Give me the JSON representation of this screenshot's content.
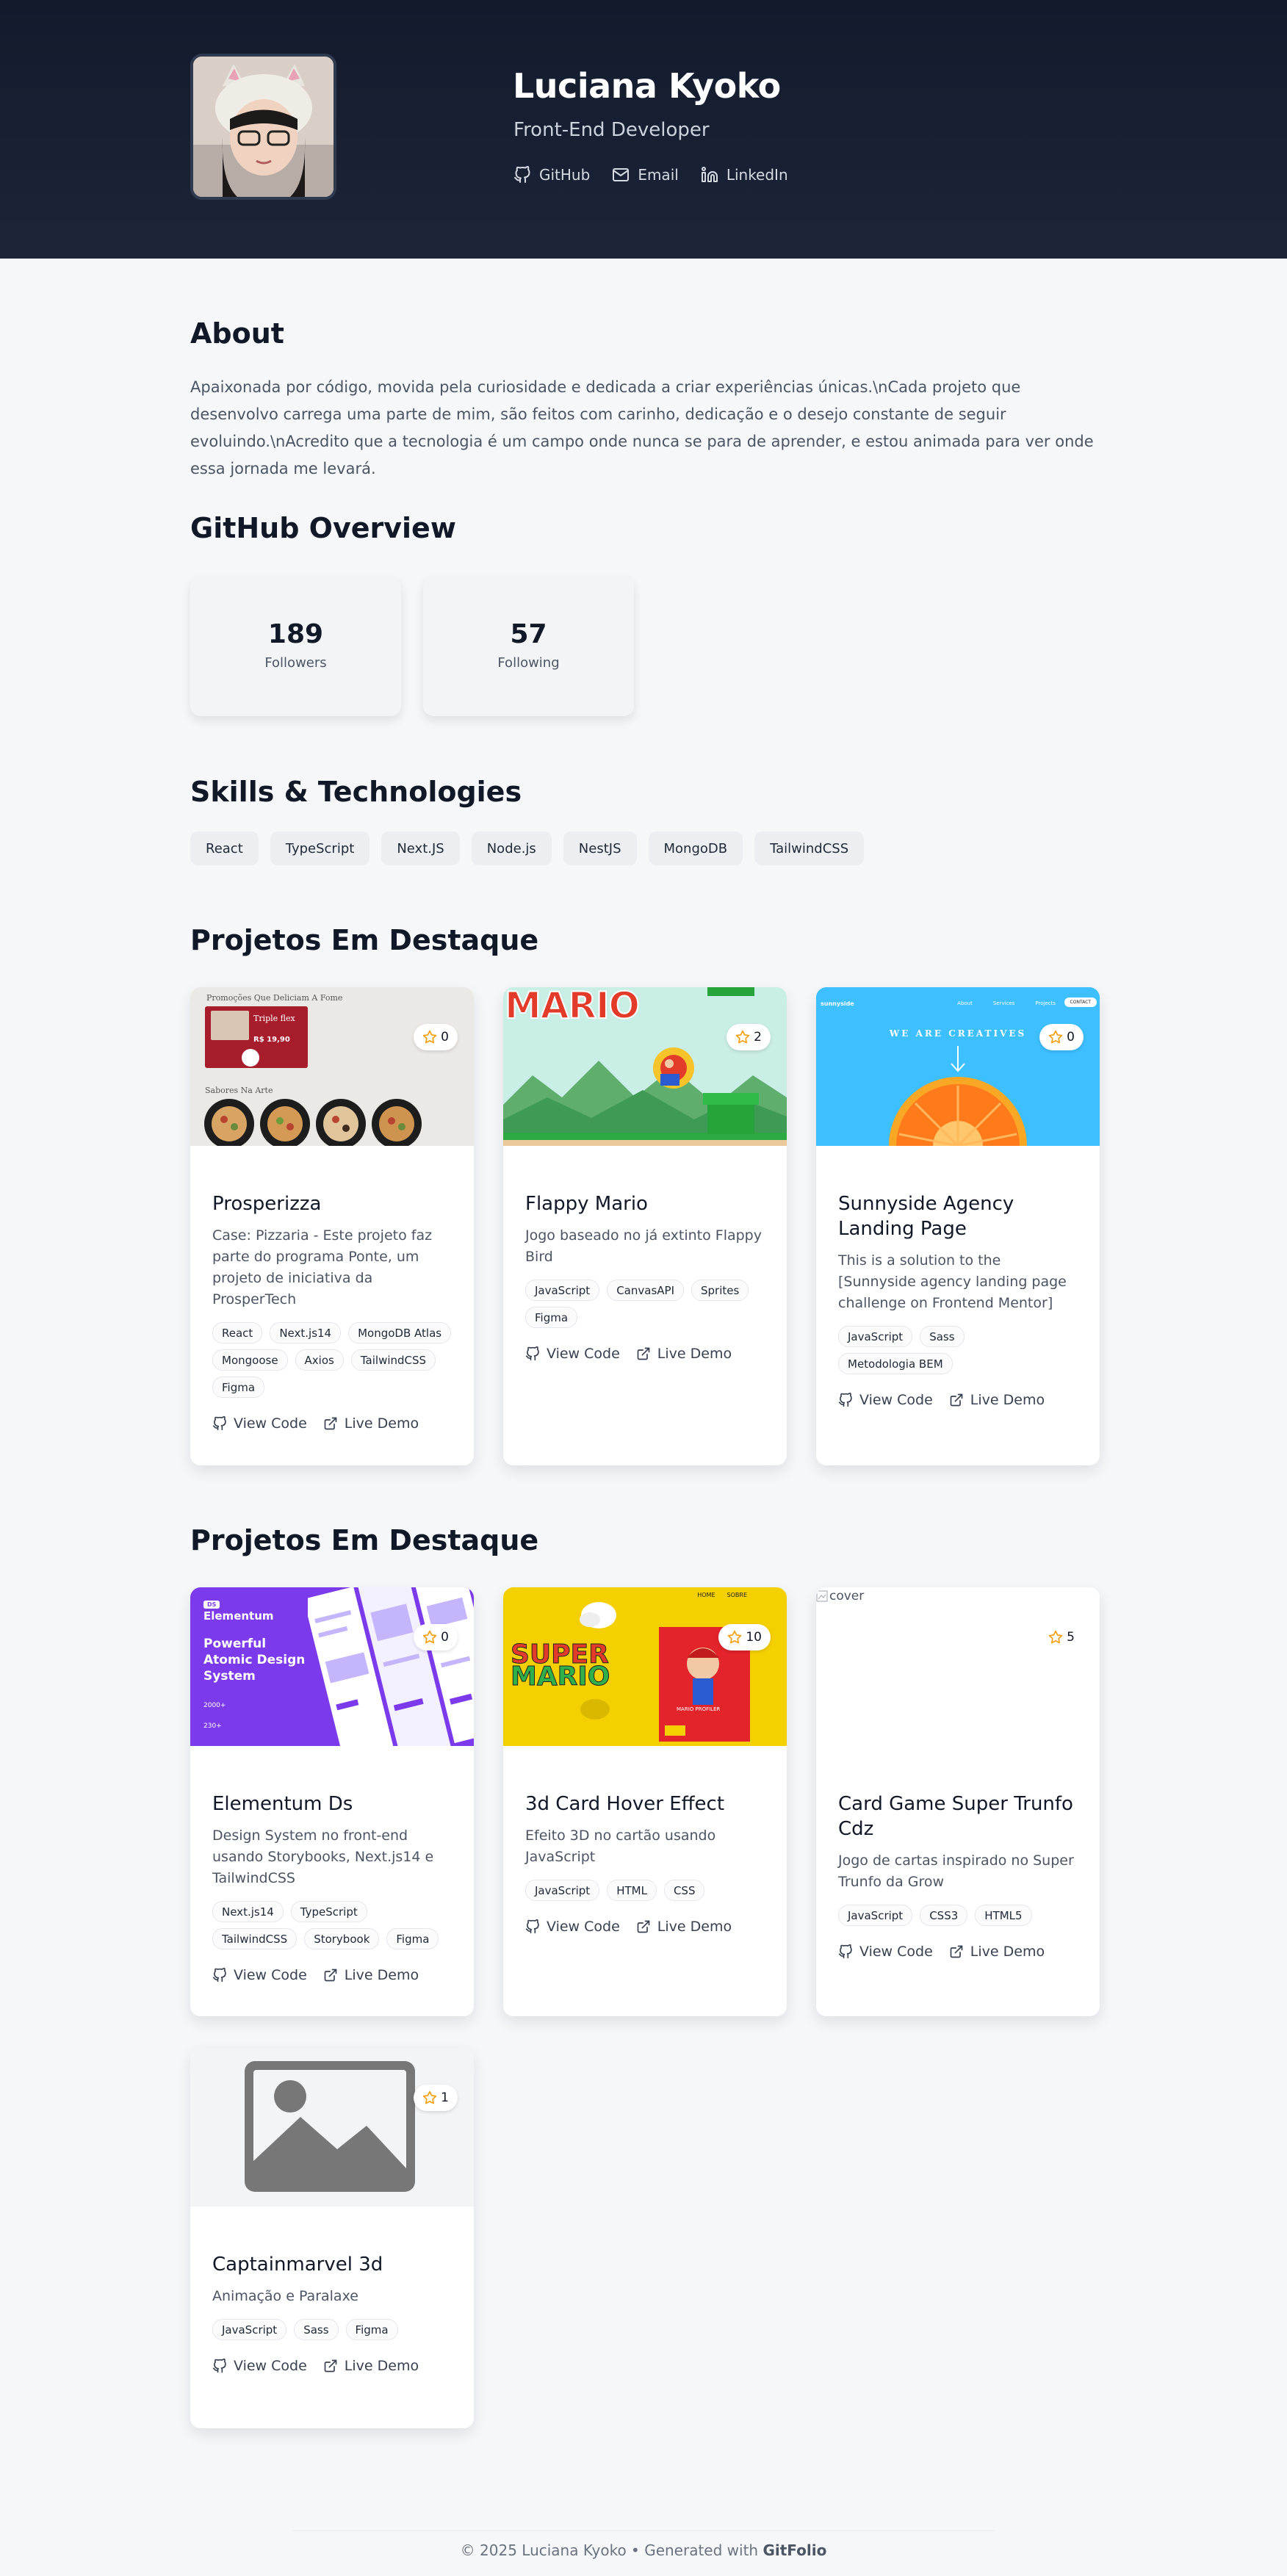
{
  "profile": {
    "name": "Luciana Kyoko",
    "role": "Front-End Developer",
    "links": [
      {
        "label": "GitHub",
        "icon": "github-icon"
      },
      {
        "label": "Email",
        "icon": "mail-icon"
      },
      {
        "label": "LinkedIn",
        "icon": "linkedin-icon"
      }
    ]
  },
  "about": {
    "title": "About",
    "text": "Apaixonada por código, movida pela curiosidade e dedicada a criar experiências únicas.\\nCada projeto que desenvolvo carrega uma parte de mim, são feitos com carinho, dedicação e o desejo constante de seguir evoluindo.\\nAcredito que a tecnologia é um campo onde nunca se para de aprender, e estou animada para ver onde essa jornada me levará."
  },
  "github": {
    "title": "GitHub Overview",
    "stats": [
      {
        "value": "189",
        "label": "Followers"
      },
      {
        "value": "57",
        "label": "Following"
      }
    ]
  },
  "skills": {
    "title": "Skills & Technologies",
    "items": [
      "React",
      "TypeScript",
      "Next.JS",
      "Node.js",
      "NestJS",
      "MongoDB",
      "TailwindCSS"
    ]
  },
  "featured1": {
    "title": "Projetos Em Destaque",
    "projects": [
      {
        "title": "Prosperizza",
        "stars": "0",
        "description": "Case: Pizzaria - Este projeto faz parte do programa Ponte, um projeto de iniciativa da ProsperTech",
        "tags": [
          "React",
          "Next.js14",
          "MongoDB Atlas",
          "Mongoose",
          "Axios",
          "TailwindCSS",
          "Figma"
        ],
        "cover": {
          "heading": "Promoções Que Deliciam A Fome",
          "subheading": "Sabores Na Arte",
          "promo_name": "Triple flex",
          "promo_price": "R$ 19,90"
        }
      },
      {
        "title": "Flappy Mario",
        "stars": "2",
        "description": "Jogo baseado no já extinto Flappy Bird",
        "tags": [
          "JavaScript",
          "CanvasAPI",
          "Sprites",
          "Figma"
        ],
        "cover": {
          "logo_text": "MARIO"
        }
      },
      {
        "title": "Sunnyside Agency Landing Page",
        "stars": "0",
        "description": "This is a solution to the [Sunnyside agency landing page challenge on Frontend Mentor]",
        "tags": [
          "JavaScript",
          "Sass",
          "Metodologia BEM"
        ],
        "cover": {
          "logo_text": "sunnyside",
          "headline": "WE ARE CREATIVES",
          "nav": [
            "About",
            "Services",
            "Projects"
          ],
          "nav_button": "CONTACT"
        }
      }
    ]
  },
  "featured2": {
    "title": "Projetos Em Destaque",
    "projects": [
      {
        "title": "Elementum Ds",
        "stars": "0",
        "description": "Design System no front-end usando Storybooks, Next.js14 e TailwindCSS",
        "tags": [
          "Next.js14",
          "TypeScript",
          "TailwindCSS",
          "Storybook",
          "Figma"
        ],
        "cover": {
          "badge": "DS",
          "brand": "Elementum",
          "tagline": "Powerful Atomic Design System",
          "stat1": "2000+",
          "stat2": "230+"
        }
      },
      {
        "title": "3d Card Hover Effect",
        "stars": "10",
        "description": "Efeito 3D no cartão usando JavaScript",
        "tags": [
          "JavaScript",
          "HTML",
          "CSS"
        ],
        "cover": {
          "logo_top": "SUPER",
          "logo_bottom": "MARIO",
          "nav": [
            "HOME",
            "SOBRE"
          ],
          "card_label": "MARIO PROFILER"
        }
      },
      {
        "title": "Card Game Super Trunfo Cdz",
        "stars": "5",
        "description": "Jogo de cartas inspirado no Super Trunfo da Grow",
        "tags": [
          "JavaScript",
          "CSS3",
          "HTML5"
        ],
        "cover": {
          "alt": "cover"
        }
      },
      {
        "title": "Captainmarvel 3d",
        "stars": "1",
        "description": "Animação e Paralaxe",
        "tags": [
          "JavaScript",
          "Sass",
          "Figma"
        ],
        "cover": {}
      }
    ]
  },
  "actions": {
    "view_code": "View Code",
    "live_demo": "Live Demo"
  },
  "footer": {
    "text": "© 2025 Luciana Kyoko • Generated with",
    "brand": "GitFolio"
  },
  "colors": {
    "hero_bg": "#141c2e",
    "page_bg": "#f6f7f9",
    "star": "#f59e0b",
    "sunnyside_bg": "#3ebfff",
    "elementum_purple": "#7c3aed",
    "mario_yellow": "#f5d000"
  }
}
